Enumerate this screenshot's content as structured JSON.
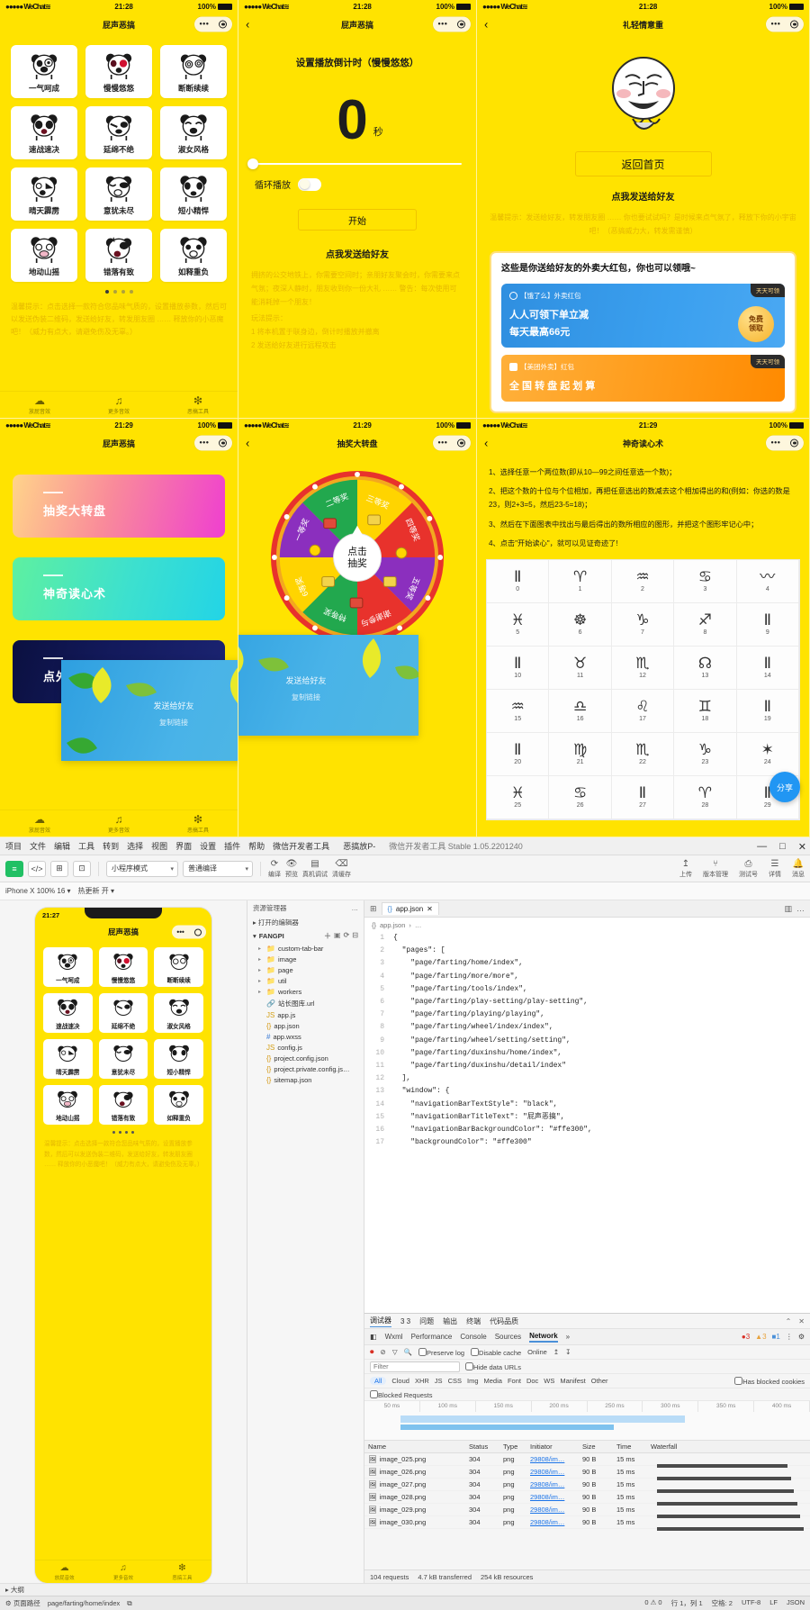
{
  "phones": [
    {
      "id": "sound-home",
      "status": {
        "carrier": "●●●●● WeChat",
        "wifi": "≋",
        "time": "21:28",
        "battery": "100%"
      },
      "nav": {
        "title": "屁声恶搞",
        "back": false
      },
      "grid_items": [
        {
          "label": "一气呵成"
        },
        {
          "label": "慢慢悠悠"
        },
        {
          "label": "断断续续"
        },
        {
          "label": "速战速决"
        },
        {
          "label": "延绵不绝"
        },
        {
          "label": "淑女风格"
        },
        {
          "label": "晴天霹雳"
        },
        {
          "label": "意犹未尽"
        },
        {
          "label": "短小精悍"
        },
        {
          "label": "地动山摇"
        },
        {
          "label": "错落有致"
        },
        {
          "label": "如释重负"
        }
      ],
      "page_dots": 4,
      "tip": "温馨提示：点击选择一款符合您品味气质的，设置播放参数，然后可以发送伪装二维码，发送给好友，转发朋友圈 …… 释放你的小恶魔吧！（威力有点大，请避免伤及无辜。）",
      "tabs": [
        {
          "icon": "cloud-icon",
          "glyph": "☁",
          "label": "放屁音效"
        },
        {
          "icon": "music-icon",
          "glyph": "♫",
          "label": "更多音效"
        },
        {
          "icon": "snowflake-icon",
          "glyph": "❇",
          "label": "恶搞工具"
        }
      ]
    },
    {
      "id": "play-setting",
      "status": {
        "carrier": "●●●●● WeChat",
        "wifi": "≋",
        "time": "21:28",
        "battery": "100%"
      },
      "nav": {
        "title": "屁声恶搞",
        "back": true
      },
      "title": "设置播放倒计时（慢慢悠悠）",
      "count": "0",
      "count_unit": "秒",
      "slider_value": 0,
      "loop_label": "循环播放",
      "loop_on": false,
      "start_button": "开始",
      "send_link": "点我发送给好友",
      "body": "拥挤的公交地铁上，你需要空间时；亲朋好友聚会时，你需要来点气氛；夜深人静时，朋友收到你一份大礼 …… 警告：每次使用可能消耗掉一个朋友！",
      "play_hint_title": "玩法提示：",
      "play_hints": [
        "1 将本机置于联身边，倒计时播放并撤离",
        "2 发送给好友进行远程攻击"
      ]
    },
    {
      "id": "share-result",
      "status": {
        "carrier": "●●●●● WeChat",
        "wifi": "≋",
        "time": "21:28",
        "battery": "100%"
      },
      "nav": {
        "title": "礼轻情意重",
        "back": true
      },
      "back_home_button": "返回首页",
      "send_link": "点我发送给好友",
      "tip": "温馨提示：发送给好友，转发朋友圈 …… 你也要试试吗？是时候来点气氛了，释放下你的小宇宙吧！（恶搞威力大，转发需谨慎）",
      "ad": {
        "headline": "这些是你送给好友的外卖大红包，你也可以领哦~",
        "banner1": {
          "tag": "天天可领",
          "brand": "【饿了么】外卖红包",
          "line1": "人人可领下单立减",
          "line2": "每天最高66元",
          "cta": "免费\n领取"
        },
        "banner2": {
          "tag": "天天可领",
          "brand": "【美团外卖】红包",
          "line1": "全 国 转 盘 起 划 算"
        }
      }
    },
    {
      "id": "tools-menu",
      "status": {
        "carrier": "●●●●● WeChat",
        "wifi": "≋",
        "time": "21:29",
        "battery": "100%"
      },
      "nav": {
        "title": "屁声恶搞",
        "back": false
      },
      "tiles": [
        {
          "label": "抽奖大转盘"
        },
        {
          "label": "神奇读心术"
        },
        {
          "label": "点外卖用的红包"
        }
      ],
      "overlay": {
        "line1": "发送给好友",
        "line2": "复制链接"
      },
      "tabs": [
        {
          "icon": "cloud-icon",
          "glyph": "☁",
          "label": "放屁音效"
        },
        {
          "icon": "music-icon",
          "glyph": "♫",
          "label": "更多音效"
        },
        {
          "icon": "snowflake-icon",
          "glyph": "❇",
          "label": "恶搞工具"
        }
      ]
    },
    {
      "id": "wheel",
      "status": {
        "carrier": "●●●●● WeChat",
        "wifi": "≋",
        "time": "21:29",
        "battery": "100%"
      },
      "nav": {
        "title": "抽奖大转盘",
        "back": true
      },
      "center_button": "点击\n抽奖",
      "slices": [
        {
          "label": "三等奖",
          "color": "#ffd400"
        },
        {
          "label": "四等奖",
          "color": "#e8322c"
        },
        {
          "label": "五等奖",
          "color": "#8b2fbe"
        },
        {
          "label": "谢谢参与",
          "color": "#e8322c"
        },
        {
          "label": "特等奖",
          "color": "#22a84e"
        },
        {
          "label": "6等奖",
          "color": "#ffd400"
        },
        {
          "label": "一等奖",
          "color": "#8b2fbe"
        },
        {
          "label": "二等奖",
          "color": "#22a84e"
        }
      ]
    },
    {
      "id": "duxinshu",
      "status": {
        "carrier": "●●●●● WeChat",
        "wifi": "≋",
        "time": "21:29",
        "battery": "100%"
      },
      "nav": {
        "title": "神奇读心术",
        "back": true
      },
      "steps": [
        "1、选择任意一个两位数(即从10—99之间任意选一个数)；",
        "2、把这个数的十位与个位相加，再把任意选出的数减去这个相加得出的和(例如：你选的数是23，则2+3=5，然后23-5=18)；",
        "3、然后在下面图表中找出与最后得出的数所相应的图形，并把这个图形牢记心中；",
        "4、点击\"开始读心\"，就可以见证奇迹了!"
      ],
      "symbols": [
        {
          "n": "0",
          "g": "Ⅱ"
        },
        {
          "n": "1",
          "g": "♈"
        },
        {
          "n": "2",
          "g": "♒"
        },
        {
          "n": "3",
          "g": "♋"
        },
        {
          "n": "4",
          "g": "〰"
        },
        {
          "n": "5",
          "g": "♓"
        },
        {
          "n": "6",
          "g": "☸"
        },
        {
          "n": "7",
          "g": "♑"
        },
        {
          "n": "8",
          "g": "♐"
        },
        {
          "n": "9",
          "g": "Ⅱ"
        },
        {
          "n": "10",
          "g": "Ⅱ"
        },
        {
          "n": "11",
          "g": "♉"
        },
        {
          "n": "12",
          "g": "♏"
        },
        {
          "n": "13",
          "g": "☊"
        },
        {
          "n": "14",
          "g": "Ⅱ"
        },
        {
          "n": "15",
          "g": "♒"
        },
        {
          "n": "16",
          "g": "♎"
        },
        {
          "n": "17",
          "g": "♌"
        },
        {
          "n": "18",
          "g": "♊"
        },
        {
          "n": "19",
          "g": "Ⅱ"
        },
        {
          "n": "20",
          "g": "Ⅱ"
        },
        {
          "n": "21",
          "g": "♍"
        },
        {
          "n": "22",
          "g": "♏"
        },
        {
          "n": "23",
          "g": "♑"
        },
        {
          "n": "24",
          "g": "✶"
        },
        {
          "n": "25",
          "g": "♓"
        },
        {
          "n": "26",
          "g": "♋"
        },
        {
          "n": "27",
          "g": "Ⅱ"
        },
        {
          "n": "28",
          "g": "♈"
        },
        {
          "n": "29",
          "g": "Ⅱ"
        }
      ],
      "share_fab": "分享"
    }
  ],
  "ide": {
    "menubar": {
      "items": [
        "项目",
        "文件",
        "编辑",
        "工具",
        "转到",
        "选择",
        "视图",
        "界面",
        "设置",
        "插件",
        "帮助",
        "微信开发者工具"
      ],
      "project": "恶搞放P-",
      "title": "微信开发者工具 Stable 1.05.2201240"
    },
    "window_controls": [
      "—",
      "□",
      "✕"
    ],
    "toolbar": {
      "buttons": [
        "≡",
        "</>",
        "⊞",
        "⊡"
      ],
      "mode_select": "小程序模式",
      "build_select": "普通编译",
      "actions": [
        "编译",
        "预览",
        "真机调试",
        "清缓存"
      ],
      "right_actions": [
        {
          "glyph": "↥",
          "label": "上传"
        },
        {
          "glyph": "⑂",
          "label": "版本管理"
        },
        {
          "glyph": "⎙",
          "label": "测试号"
        },
        {
          "glyph": "☰",
          "label": "详情"
        },
        {
          "glyph": "🔔",
          "label": "消息"
        }
      ]
    },
    "subbar": {
      "device": "iPhone X 100% 16 ▾",
      "mode": "热更新 开 ▾",
      "sim_icons": [
        "⟲",
        "⤢",
        "▭",
        "⊡",
        "⧉",
        "🔍",
        "⊕",
        "⊟",
        "⊞",
        "⊘"
      ]
    },
    "explorer": {
      "title": "资源管理器",
      "section": "打开的编辑器",
      "root": "FANGPI",
      "items": [
        {
          "name": "custom-tab-bar",
          "type": "folder"
        },
        {
          "name": "image",
          "type": "folder"
        },
        {
          "name": "page",
          "type": "folder"
        },
        {
          "name": "util",
          "type": "folder"
        },
        {
          "name": "workers",
          "type": "folder"
        },
        {
          "name": "站长图库.url",
          "type": "link"
        },
        {
          "name": "app.js",
          "type": "js"
        },
        {
          "name": "app.json",
          "type": "json"
        },
        {
          "name": "app.wxss",
          "type": "wxss"
        },
        {
          "name": "config.js",
          "type": "js"
        },
        {
          "name": "project.config.json",
          "type": "json"
        },
        {
          "name": "project.private.config.js…",
          "type": "json"
        },
        {
          "name": "sitemap.json",
          "type": "json"
        }
      ]
    },
    "editor": {
      "tab": "app.json",
      "breadcrumb": [
        "app.json",
        "…"
      ],
      "lines": [
        {
          "n": "1",
          "t": "{"
        },
        {
          "n": "2",
          "t": "  \"pages\": ["
        },
        {
          "n": "3",
          "t": "    \"page/farting/home/index\","
        },
        {
          "n": "4",
          "t": "    \"page/farting/more/more\","
        },
        {
          "n": "5",
          "t": "    \"page/farting/tools/index\","
        },
        {
          "n": "6",
          "t": "    \"page/farting/play-setting/play-setting\","
        },
        {
          "n": "7",
          "t": "    \"page/farting/playing/playing\","
        },
        {
          "n": "8",
          "t": "    \"page/farting/wheel/index/index\","
        },
        {
          "n": "9",
          "t": "    \"page/farting/wheel/setting/setting\","
        },
        {
          "n": "10",
          "t": "    \"page/farting/duxinshu/home/index\","
        },
        {
          "n": "11",
          "t": "    \"page/farting/duxinshu/detail/index\""
        },
        {
          "n": "12",
          "t": "  ],"
        },
        {
          "n": "13",
          "t": "  \"window\": {"
        },
        {
          "n": "14",
          "t": "    \"navigationBarTextStyle\": \"black\","
        },
        {
          "n": "15",
          "t": "    \"navigationBarTitleText\": \"屁声恶搞\","
        },
        {
          "n": "16",
          "t": "    \"navigationBarBackgroundColor\": \"#ffe300\","
        },
        {
          "n": "17",
          "t": "    \"backgroundColor\": \"#ffe300\""
        }
      ]
    },
    "devtools": {
      "header": {
        "title": "调试器",
        "counts": "3 3",
        "right": [
          "问题",
          "输出",
          "终端",
          "代码品质"
        ]
      },
      "tabs": [
        "Wxml",
        "Performance",
        "Console",
        "Sources",
        "Network",
        "»"
      ],
      "badges": {
        "errors": "3",
        "warnings": "3",
        "info": "1"
      },
      "controls": [
        "Preserve log",
        "Disable cache",
        "Online"
      ],
      "filter_placeholder": "Filter",
      "hide_data_urls": "Hide data URLs",
      "types": [
        "All",
        "Cloud",
        "XHR",
        "JS",
        "CSS",
        "Img",
        "Media",
        "Font",
        "Doc",
        "WS",
        "Manifest",
        "Other"
      ],
      "has_blocked_cookies": "Has blocked cookies",
      "blocked_requests": "Blocked Requests",
      "timeline_ticks": [
        "50 ms",
        "100 ms",
        "150 ms",
        "200 ms",
        "250 ms",
        "300 ms",
        "350 ms",
        "400 ms"
      ],
      "columns": [
        "Name",
        "Status",
        "Type",
        "Initiator",
        "Size",
        "Time",
        "Waterfall"
      ],
      "rows": [
        {
          "name": "image_025.png",
          "status": "304",
          "type": "png",
          "initiator": "29808/im…",
          "size": "90 B",
          "time": "15 ms"
        },
        {
          "name": "image_026.png",
          "status": "304",
          "type": "png",
          "initiator": "29808/im…",
          "size": "90 B",
          "time": "15 ms"
        },
        {
          "name": "image_027.png",
          "status": "304",
          "type": "png",
          "initiator": "29808/im…",
          "size": "90 B",
          "time": "15 ms"
        },
        {
          "name": "image_028.png",
          "status": "304",
          "type": "png",
          "initiator": "29808/im…",
          "size": "90 B",
          "time": "15 ms"
        },
        {
          "name": "image_029.png",
          "status": "304",
          "type": "png",
          "initiator": "29808/im…",
          "size": "90 B",
          "time": "15 ms"
        },
        {
          "name": "image_030.png",
          "status": "304",
          "type": "png",
          "initiator": "29808/im…",
          "size": "90 B",
          "time": "15 ms"
        }
      ],
      "footer": [
        "104 requests",
        "4.7 kB transferred",
        "254 kB resources"
      ]
    },
    "sim_phone": {
      "time": "21:27",
      "title": "屁声恶搞",
      "tip": "温馨提示：点击选择一款符合您品味气质的，设置播放参数，然后可以发送伪装二维码，发送给好友，转发朋友圈 …… 释放你的小恶魔吧！（威力有点大，请避免伤及无辜。）"
    },
    "statusbar": {
      "left": "页面路径",
      "path": "page/farting/home/index",
      "right": [
        "行 1，列 1",
        "空格: 2",
        "UTF-8",
        "LF",
        "JSON"
      ]
    },
    "bottom_rail": {
      "label": "大纲",
      "counts": [
        "0 ⚠ 0",
        "⛔ 0"
      ]
    }
  }
}
